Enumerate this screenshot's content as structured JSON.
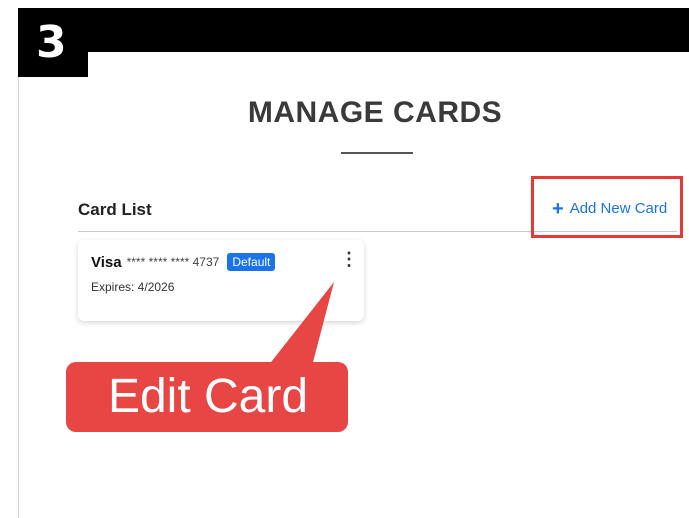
{
  "step": {
    "number": "3"
  },
  "page": {
    "title": "MANAGE CARDS"
  },
  "card_list": {
    "heading": "Card List",
    "add_new_label": "Add New Card",
    "add_icon": "plus-icon",
    "accent_color": "#1a73e8"
  },
  "cards": [
    {
      "brand": "Visa",
      "number": "**** **** **** 4737",
      "badge": "Default",
      "expires": "Expires: 4/2026",
      "menu_icon": "kebab-menu-icon"
    }
  ],
  "callout": {
    "label": "Edit Card",
    "color": "#e84545"
  },
  "highlight": {
    "color": "#e53935"
  }
}
